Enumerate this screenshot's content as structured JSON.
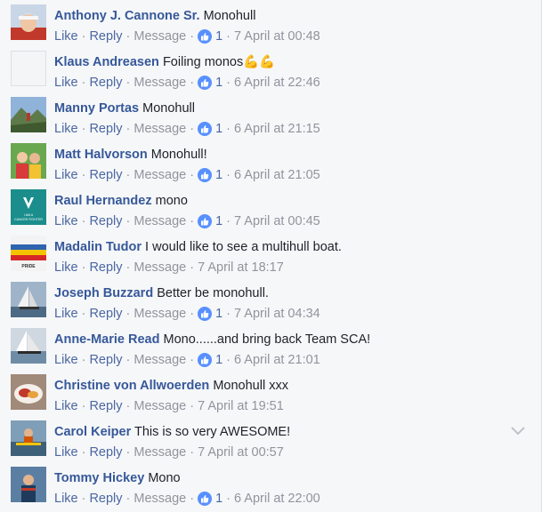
{
  "actions": {
    "like": "Like",
    "reply": "Reply",
    "message": "Message",
    "separator": "·"
  },
  "colors": {
    "author": "#365899",
    "link": "#4b67a1",
    "muted": "#90949c",
    "like_badge": "#5890ff",
    "background": "#f6f7f9"
  },
  "comments": [
    {
      "author": "Anthony J. Cannone Sr.",
      "text": "Monohull",
      "likes": "1",
      "time": "7 April at 00:48",
      "avatar": "man-cap-avatar"
    },
    {
      "author": "Klaus Andreasen",
      "text": "Foiling monos💪💪",
      "likes": "1",
      "time": "6 April at 22:46",
      "avatar": "blank-avatar"
    },
    {
      "author": "Manny Portas",
      "text": "Monohull",
      "likes": "1",
      "time": "6 April at 21:15",
      "avatar": "landscape-avatar"
    },
    {
      "author": "Matt Halvorson",
      "text": "Monohull!",
      "likes": "1",
      "time": "6 April at 21:05",
      "avatar": "family-avatar"
    },
    {
      "author": "Raul Hernandez",
      "text": "mono",
      "likes": "1",
      "time": "7 April at 00:45",
      "avatar": "cancer-fighter-avatar",
      "avatar_text": "I AM A CANCER FIGHTER"
    },
    {
      "author": "Madalin Tudor",
      "text": "I would like to see a multihull boat.",
      "likes": "",
      "time": "7 April at 18:17",
      "avatar": "pride-avatar",
      "avatar_text": "PRIDE"
    },
    {
      "author": "Joseph Buzzard",
      "text": "Better be monohull.",
      "likes": "1",
      "time": "7 April at 04:34",
      "avatar": "sailboat-avatar"
    },
    {
      "author": "Anne-Marie Read",
      "text": "Mono......and bring back Team SCA!",
      "likes": "1",
      "time": "6 April at 21:01",
      "avatar": "yacht-avatar"
    },
    {
      "author": "Christine von Allwoerden",
      "text": "Monohull xxx",
      "likes": "",
      "time": "7 April at 19:51",
      "avatar": "food-avatar"
    },
    {
      "author": "Carol Keiper",
      "text": "This is so very AWESOME!",
      "likes": "",
      "time": "7 April at 00:57",
      "avatar": "kayak-avatar"
    },
    {
      "author": "Tommy Hickey",
      "text": "Mono",
      "likes": "1",
      "time": "6 April at 22:00",
      "avatar": "sailor-avatar"
    }
  ],
  "options_icon": "chevron-down-icon"
}
